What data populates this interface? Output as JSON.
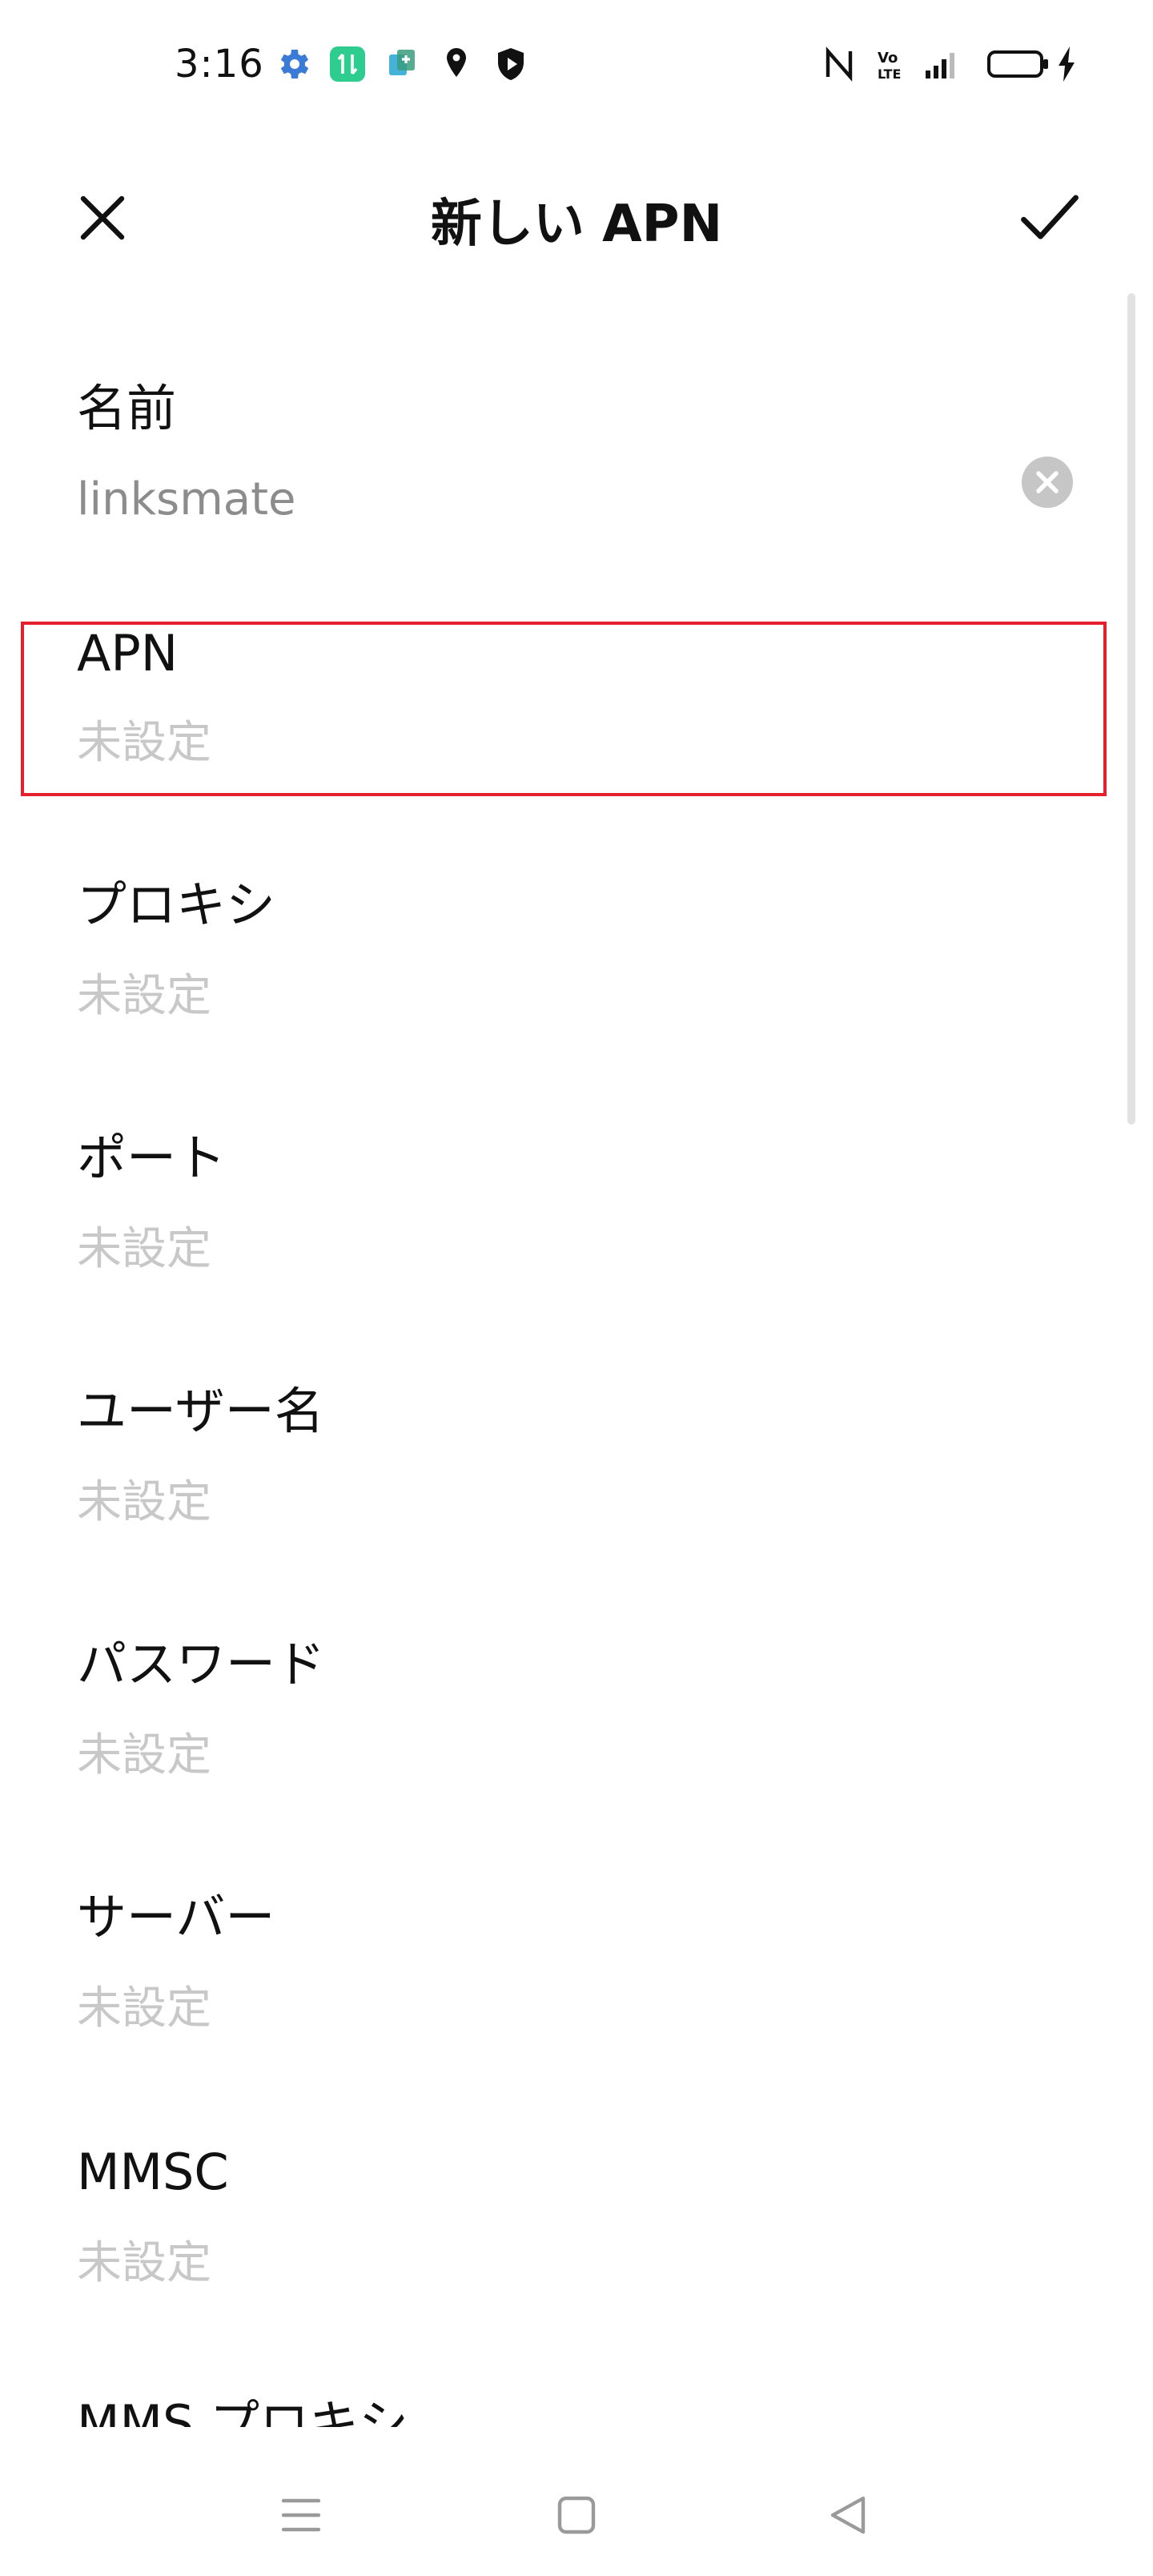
{
  "status_bar": {
    "time": "3:16",
    "icons_left": [
      "settings-icon",
      "data-transfer-app-icon",
      "app-clone-icon",
      "location-pin-icon",
      "shield-icon"
    ],
    "icons_right": [
      "nfc-icon",
      "volte-icon",
      "signal-icon",
      "battery-icon",
      "charging-bolt-icon"
    ]
  },
  "header": {
    "title": "新しい APN",
    "close_icon": "close-icon",
    "confirm_icon": "check-icon"
  },
  "fields": [
    {
      "label": "名前",
      "value": "linksmate",
      "is_set": true
    },
    {
      "label": "APN",
      "value": "未設定",
      "is_set": false
    },
    {
      "label": "プロキシ",
      "value": "未設定",
      "is_set": false
    },
    {
      "label": "ポート",
      "value": "未設定",
      "is_set": false
    },
    {
      "label": "ユーザー名",
      "value": "未設定",
      "is_set": false
    },
    {
      "label": "パスワード",
      "value": "未設定",
      "is_set": false
    },
    {
      "label": "サーバー",
      "value": "未設定",
      "is_set": false
    },
    {
      "label": "MMSC",
      "value": "未設定",
      "is_set": false
    },
    {
      "label": "MMS プロキシ"
    }
  ],
  "highlight_color": "#e3202b",
  "nav_bar": {
    "icons": [
      "menu-icon",
      "home-icon",
      "back-icon"
    ]
  }
}
